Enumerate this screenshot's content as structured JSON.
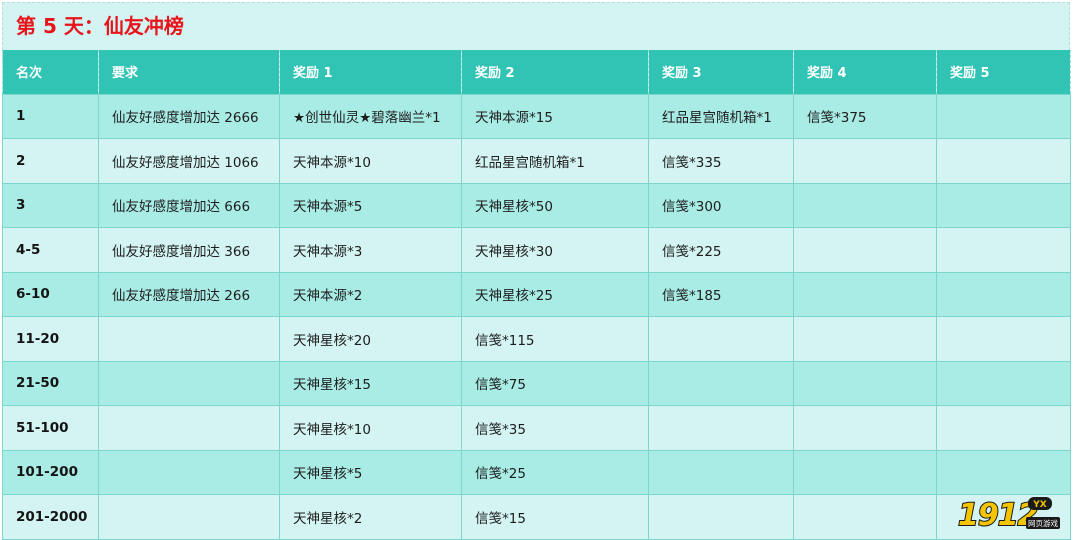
{
  "title": "第 5 天：仙友冲榜",
  "table": {
    "headers": [
      "名次",
      "要求",
      "奖励 1",
      "奖励 2",
      "奖励 3",
      "奖励 4",
      "奖励 5"
    ],
    "rows": [
      [
        "1",
        "仙友好感度增加达 2666",
        "★创世仙灵★碧落幽兰*1",
        "天神本源*15",
        "红品星宫随机箱*1",
        "信笺*375",
        ""
      ],
      [
        "2",
        "仙友好感度增加达 1066",
        "天神本源*10",
        "红品星宫随机箱*1",
        "信笺*335",
        "",
        ""
      ],
      [
        "3",
        "仙友好感度增加达 666",
        "天神本源*5",
        "天神星核*50",
        "信笺*300",
        "",
        ""
      ],
      [
        "4-5",
        "仙友好感度增加达 366",
        "天神本源*3",
        "天神星核*30",
        "信笺*225",
        "",
        ""
      ],
      [
        "6-10",
        "仙友好感度增加达 266",
        "天神本源*2",
        "天神星核*25",
        "信笺*185",
        "",
        ""
      ],
      [
        "11-20",
        "",
        "天神星核*20",
        "信笺*115",
        "",
        "",
        ""
      ],
      [
        "21-50",
        "",
        "天神星核*15",
        "信笺*75",
        "",
        "",
        ""
      ],
      [
        "51-100",
        "",
        "天神星核*10",
        "信笺*35",
        "",
        "",
        ""
      ],
      [
        "101-200",
        "",
        "天神星核*5",
        "信笺*25",
        "",
        "",
        ""
      ],
      [
        "201-2000",
        "",
        "天神星核*2",
        "信笺*15",
        "",
        "",
        ""
      ]
    ]
  },
  "watermark": {
    "text": "1912",
    "badge": "YX",
    "tagline": "网页游戏",
    "colors": {
      "text": "#f5c400",
      "outline": "#1a1a1a",
      "badge": "#3aa0e0"
    }
  },
  "colors": {
    "title": "#e8141b",
    "header_bg": "#31c4b5",
    "row_dark": "#a9ece5",
    "row_light": "#d3f4f2",
    "border": "#7dd6cc"
  }
}
